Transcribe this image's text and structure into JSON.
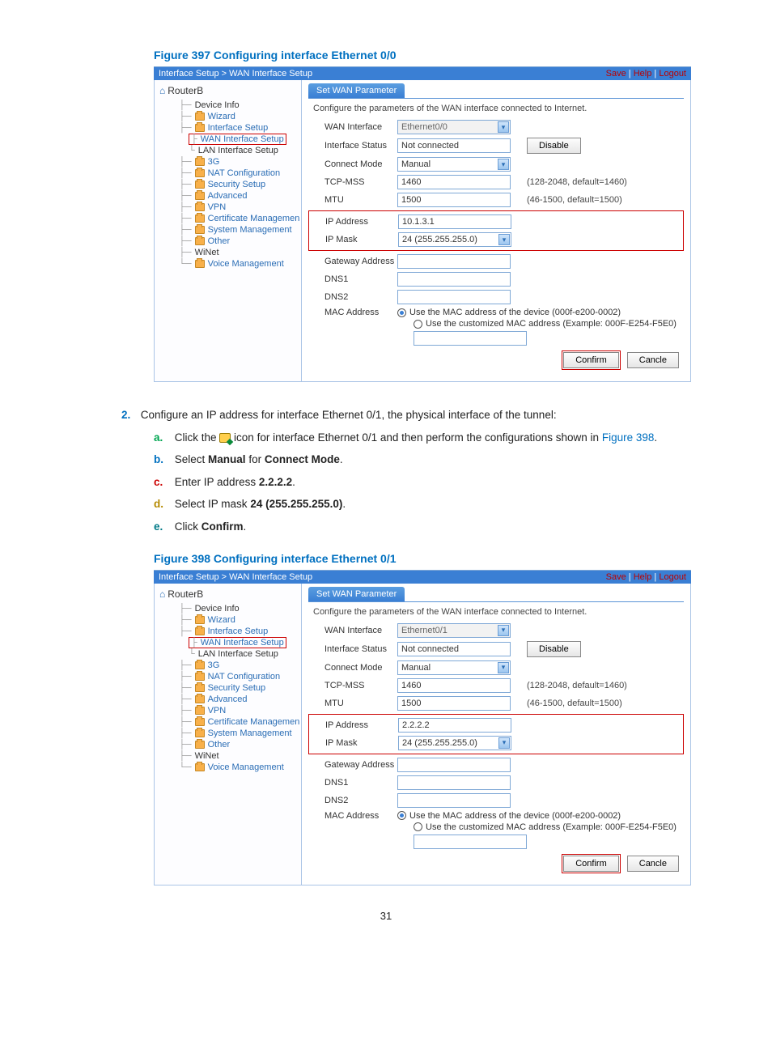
{
  "page_number": "31",
  "figures": [
    {
      "title": "Figure 397 Configuring interface Ethernet 0/0",
      "breadcrumb": "Interface Setup > WAN Interface Setup",
      "top_links": {
        "save": "Save",
        "help": "Help",
        "logout": "Logout"
      },
      "hostname": "RouterB",
      "nav": {
        "device_info": "Device Info",
        "wizard": "Wizard",
        "interface_setup": "Interface Setup",
        "wan": "WAN Interface Setup",
        "lan": "LAN Interface Setup",
        "three_g": "3G",
        "nat": "NAT Configuration",
        "security": "Security Setup",
        "advanced": "Advanced",
        "vpn": "VPN",
        "cert": "Certificate Managemen",
        "sysmgmt": "System Management",
        "other": "Other",
        "winet": "WiNet",
        "voice": "Voice Management"
      },
      "tab_label": "Set WAN Parameter",
      "description": "Configure the parameters of the WAN interface connected to Internet.",
      "labels": {
        "wan_interface": "WAN Interface",
        "interface_status": "Interface Status",
        "connect_mode": "Connect Mode",
        "tcp_mss": "TCP-MSS",
        "mtu": "MTU",
        "ip_address": "IP Address",
        "ip_mask": "IP Mask",
        "gateway": "Gateway Address",
        "dns1": "DNS1",
        "dns2": "DNS2",
        "mac": "MAC Address"
      },
      "values": {
        "wan_interface": "Ethernet0/0",
        "interface_status": "Not connected",
        "disable_btn": "Disable",
        "connect_mode": "Manual",
        "tcp_mss": "1460",
        "tcp_mss_hint": "(128-2048, default=1460)",
        "mtu": "1500",
        "mtu_hint": "(46-1500, default=1500)",
        "ip_address": "10.1.3.1",
        "ip_mask": "24 (255.255.255.0)",
        "gateway": "",
        "dns1": "",
        "dns2": "",
        "mac_opt1": "Use the MAC address of the device (000f-e200-0002)",
        "mac_opt2": "Use the customized MAC address (Example: 000F-E254-F5E0)",
        "confirm_btn": "Confirm",
        "cancel_btn": "Cancle"
      }
    },
    {
      "title": "Figure 398 Configuring interface Ethernet 0/1",
      "breadcrumb": "Interface Setup > WAN Interface Setup",
      "top_links": {
        "save": "Save",
        "help": "Help",
        "logout": "Logout"
      },
      "hostname": "RouterB",
      "nav": {
        "device_info": "Device Info",
        "wizard": "Wizard",
        "interface_setup": "Interface Setup",
        "wan": "WAN Interface Setup",
        "lan": "LAN Interface Setup",
        "three_g": "3G",
        "nat": "NAT Configuration",
        "security": "Security Setup",
        "advanced": "Advanced",
        "vpn": "VPN",
        "cert": "Certificate Managemen",
        "sysmgmt": "System Management",
        "other": "Other",
        "winet": "WiNet",
        "voice": "Voice Management"
      },
      "tab_label": "Set WAN Parameter",
      "description": "Configure the parameters of the WAN interface connected to Internet.",
      "labels": {
        "wan_interface": "WAN Interface",
        "interface_status": "Interface Status",
        "connect_mode": "Connect Mode",
        "tcp_mss": "TCP-MSS",
        "mtu": "MTU",
        "ip_address": "IP Address",
        "ip_mask": "IP Mask",
        "gateway": "Gateway Address",
        "dns1": "DNS1",
        "dns2": "DNS2",
        "mac": "MAC Address"
      },
      "values": {
        "wan_interface": "Ethernet0/1",
        "interface_status": "Not connected",
        "disable_btn": "Disable",
        "connect_mode": "Manual",
        "tcp_mss": "1460",
        "tcp_mss_hint": "(128-2048, default=1460)",
        "mtu": "1500",
        "mtu_hint": "(46-1500, default=1500)",
        "ip_address": "2.2.2.2",
        "ip_mask": "24 (255.255.255.0)",
        "gateway": "",
        "dns1": "",
        "dns2": "",
        "mac_opt1": "Use the MAC address of the device (000f-e200-0002)",
        "mac_opt2": "Use the customized MAC address (Example: 000F-E254-F5E0)",
        "confirm_btn": "Confirm",
        "cancel_btn": "Cancle"
      }
    }
  ],
  "step": {
    "number": "2.",
    "text_1": "Configure an IP address for interface Ethernet 0/1, the physical interface of the tunnel:",
    "a_pre": "Click the ",
    "a_mid": " icon for interface Ethernet 0/1 and then perform the configurations shown in ",
    "a_figref": "Figure 398",
    "a_post": ".",
    "b_pre": "Select ",
    "b_bold1": "Manual",
    "b_mid": " for ",
    "b_bold2": "Connect Mode",
    "b_post": ".",
    "c_pre": "Enter IP address ",
    "c_bold": "2.2.2.2",
    "c_post": ".",
    "d_pre": "Select IP mask ",
    "d_bold": "24 (255.255.255.0)",
    "d_post": ".",
    "e_pre": "Click ",
    "e_bold": "Confirm",
    "e_post": "."
  }
}
